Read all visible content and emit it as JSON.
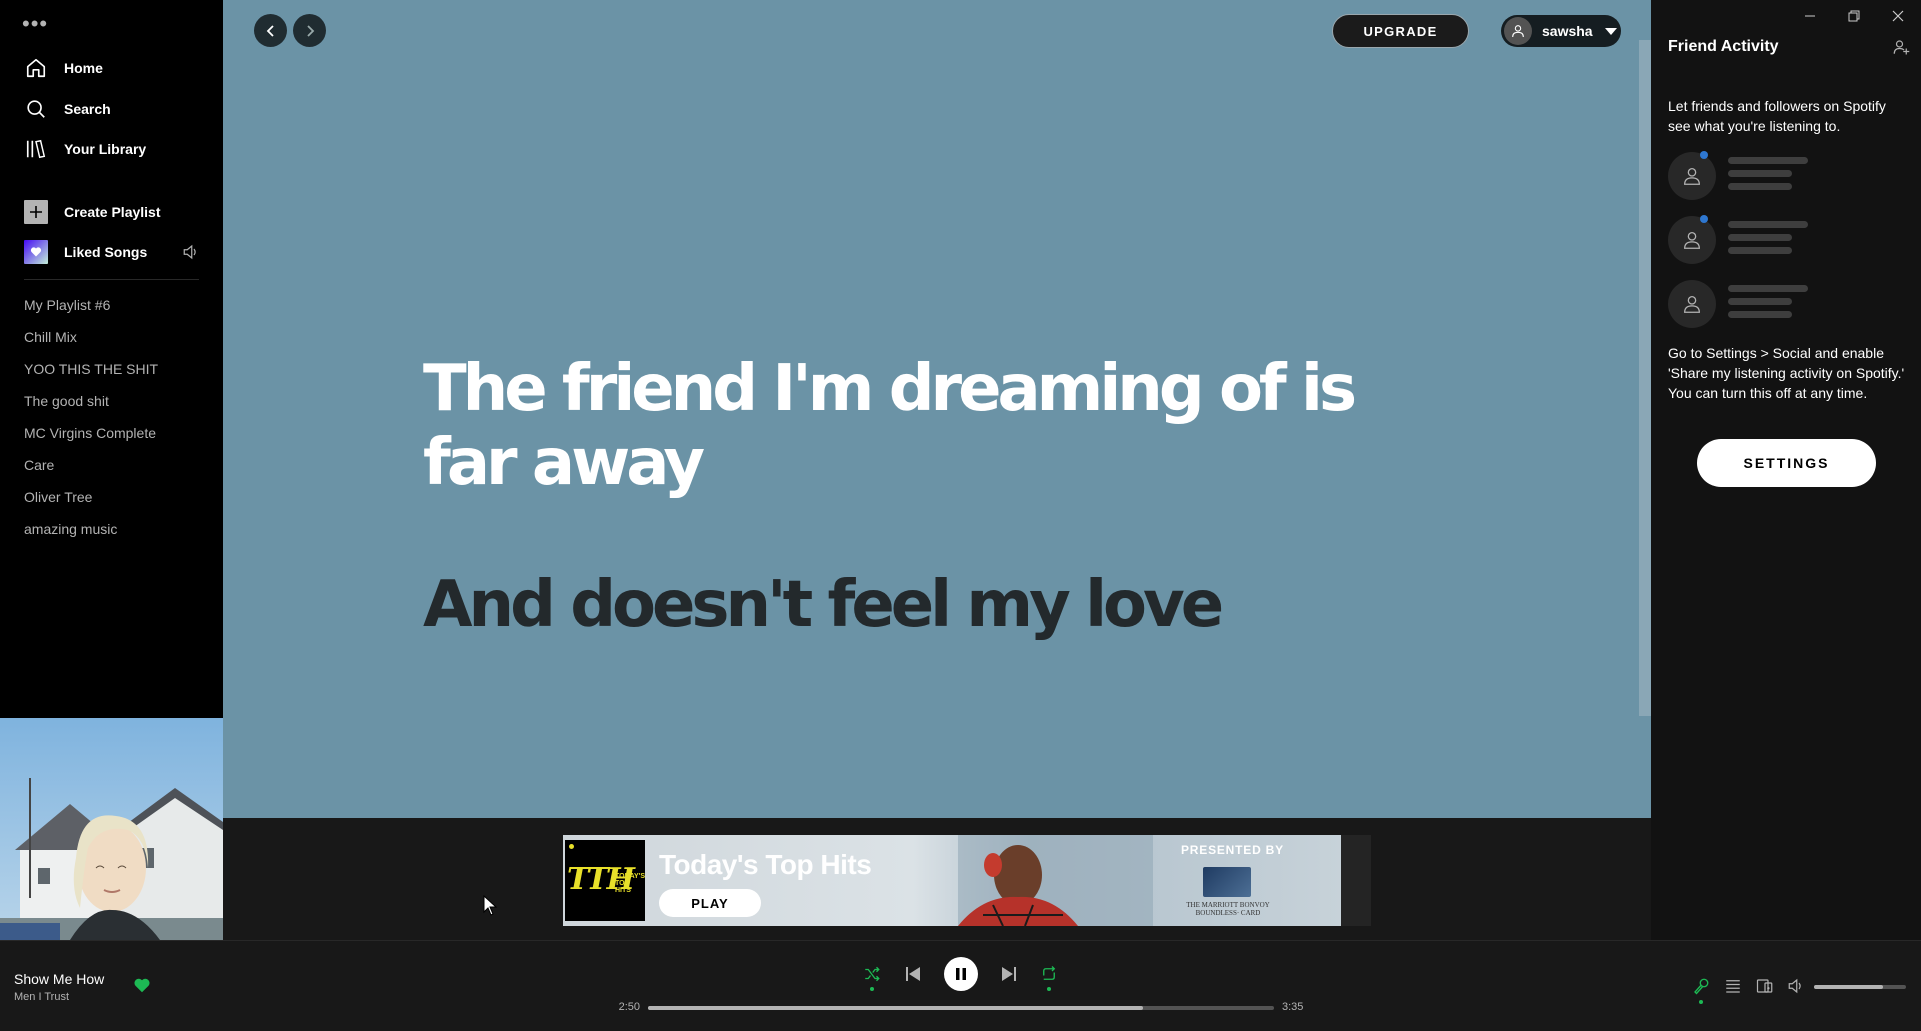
{
  "sidebar": {
    "menu_icon": "more-dots-icon",
    "nav": [
      {
        "label": "Home",
        "icon": "home-icon"
      },
      {
        "label": "Search",
        "icon": "search-icon"
      },
      {
        "label": "Your Library",
        "icon": "library-icon"
      }
    ],
    "create_playlist": "Create Playlist",
    "liked_songs": "Liked Songs",
    "playlists": [
      "My Playlist #6",
      "Chill Mix",
      "YOO THIS THE SHIT",
      "The good shit",
      "MC Virgins Complete",
      "Care",
      "Oliver Tree",
      "amazing music"
    ]
  },
  "topbar": {
    "upgrade": "UPGRADE",
    "username": "sawsha"
  },
  "lyrics": {
    "current": "The friend I'm dreaming of is far away",
    "next": "And doesn't feel my love"
  },
  "ad": {
    "logo_text": "TTH",
    "logo_sub": "TODAY'S TOP HITS",
    "title": "Today's Top Hits",
    "play": "PLAY",
    "presented_by": "PRESENTED BY",
    "card_text": "THE MARRIOTT BONVOY BOUNDLESS· CARD"
  },
  "friend_activity": {
    "title": "Friend Activity",
    "intro": "Let friends and followers on Spotify see what you're listening to.",
    "outro": "Go to Settings > Social and enable 'Share my listening activity on Spotify.' You can turn this off at any time.",
    "settings_button": "SETTINGS"
  },
  "player": {
    "track": "Show Me How",
    "artist": "Men I Trust",
    "liked": true,
    "elapsed": "2:50",
    "duration": "3:35",
    "progress_fraction": 0.79,
    "volume_fraction": 0.75,
    "shuffle_active": true,
    "repeat_active": true,
    "is_playing": true
  },
  "colors": {
    "lyrics_background": "#6b93a6",
    "accent_green": "#1db954",
    "next_lyric": "#23292c"
  }
}
